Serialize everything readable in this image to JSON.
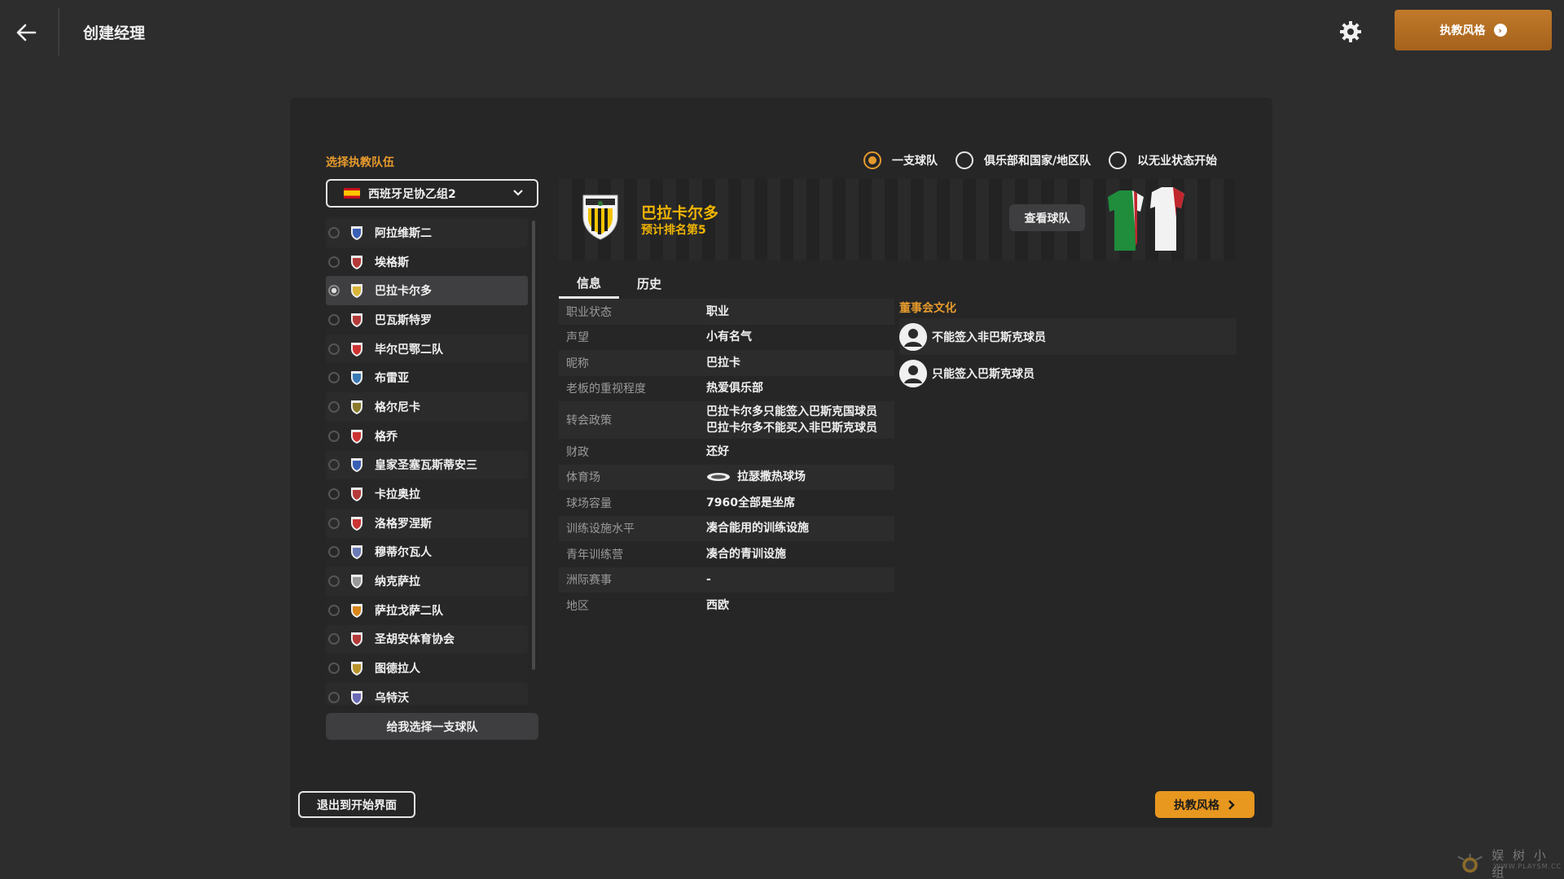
{
  "header": {
    "title": "创建经理",
    "top_right_button": "执教风格"
  },
  "team_select": {
    "label": "选择执教队伍",
    "league": "西班牙足协乙组2",
    "teams": [
      {
        "name": "阿拉维斯二",
        "selected": false
      },
      {
        "name": "埃格斯",
        "selected": false
      },
      {
        "name": "巴拉卡尔多",
        "selected": true
      },
      {
        "name": "巴瓦斯特罗",
        "selected": false
      },
      {
        "name": "毕尔巴鄂二队",
        "selected": false
      },
      {
        "name": "布雷亚",
        "selected": false
      },
      {
        "name": "格尔尼卡",
        "selected": false
      },
      {
        "name": "格乔",
        "selected": false
      },
      {
        "name": "皇家圣塞瓦斯蒂安三",
        "selected": false
      },
      {
        "name": "卡拉奥拉",
        "selected": false
      },
      {
        "name": "洛格罗涅斯",
        "selected": false
      },
      {
        "name": "穆蒂尔瓦人",
        "selected": false
      },
      {
        "name": "纳克萨拉",
        "selected": false
      },
      {
        "name": "萨拉戈萨二队",
        "selected": false
      },
      {
        "name": "圣胡安体育协会",
        "selected": false
      },
      {
        "name": "图德拉人",
        "selected": false
      },
      {
        "name": "乌特沃",
        "selected": false
      }
    ],
    "pick_for_me": "给我选择一支球队"
  },
  "modes": {
    "options": [
      "一支球队",
      "俱乐部和国家/地区队",
      "以无业状态开始"
    ],
    "selected_index": 0
  },
  "club": {
    "name": "巴拉卡尔多",
    "predicted_rank": "预计排名第5",
    "view_team": "查看球队"
  },
  "tabs": [
    "信息",
    "历史"
  ],
  "info": {
    "rows": [
      {
        "k": "职业状态",
        "v": "职业"
      },
      {
        "k": "声望",
        "v": "小有名气"
      },
      {
        "k": "昵称",
        "v": "巴拉卡"
      },
      {
        "k": "老板的重视程度",
        "v": "热爱俱乐部"
      },
      {
        "k": "转会政策",
        "v": "巴拉卡尔多只能签入巴斯克国球员",
        "v2": "巴拉卡尔多不能买入非巴斯克球员"
      },
      {
        "k": "财政",
        "v": "还好"
      },
      {
        "k": "体育场",
        "v": "拉瑟撒热球场"
      },
      {
        "k": "球场容量",
        "v": "7960全部是坐席"
      },
      {
        "k": "训练设施水平",
        "v": "凑合能用的训练设施"
      },
      {
        "k": "青年训练营",
        "v": "凑合的青训设施"
      },
      {
        "k": "洲际赛事",
        "v": "-"
      },
      {
        "k": "地区",
        "v": "西欧"
      }
    ]
  },
  "board": {
    "label": "董事会文化",
    "items": [
      "不能签入非巴斯克球员",
      "只能签入巴斯克球员"
    ]
  },
  "footer": {
    "exit": "退出到开始界面",
    "next": "执教风格"
  },
  "watermark": {
    "text": "娱 树 小 组",
    "sub": "WWW.PLAYSM.CC"
  },
  "colors": {
    "accent": "#e8971f",
    "club_name": "#f0b400",
    "background": "#2d2d2e",
    "panel": "#262627"
  }
}
